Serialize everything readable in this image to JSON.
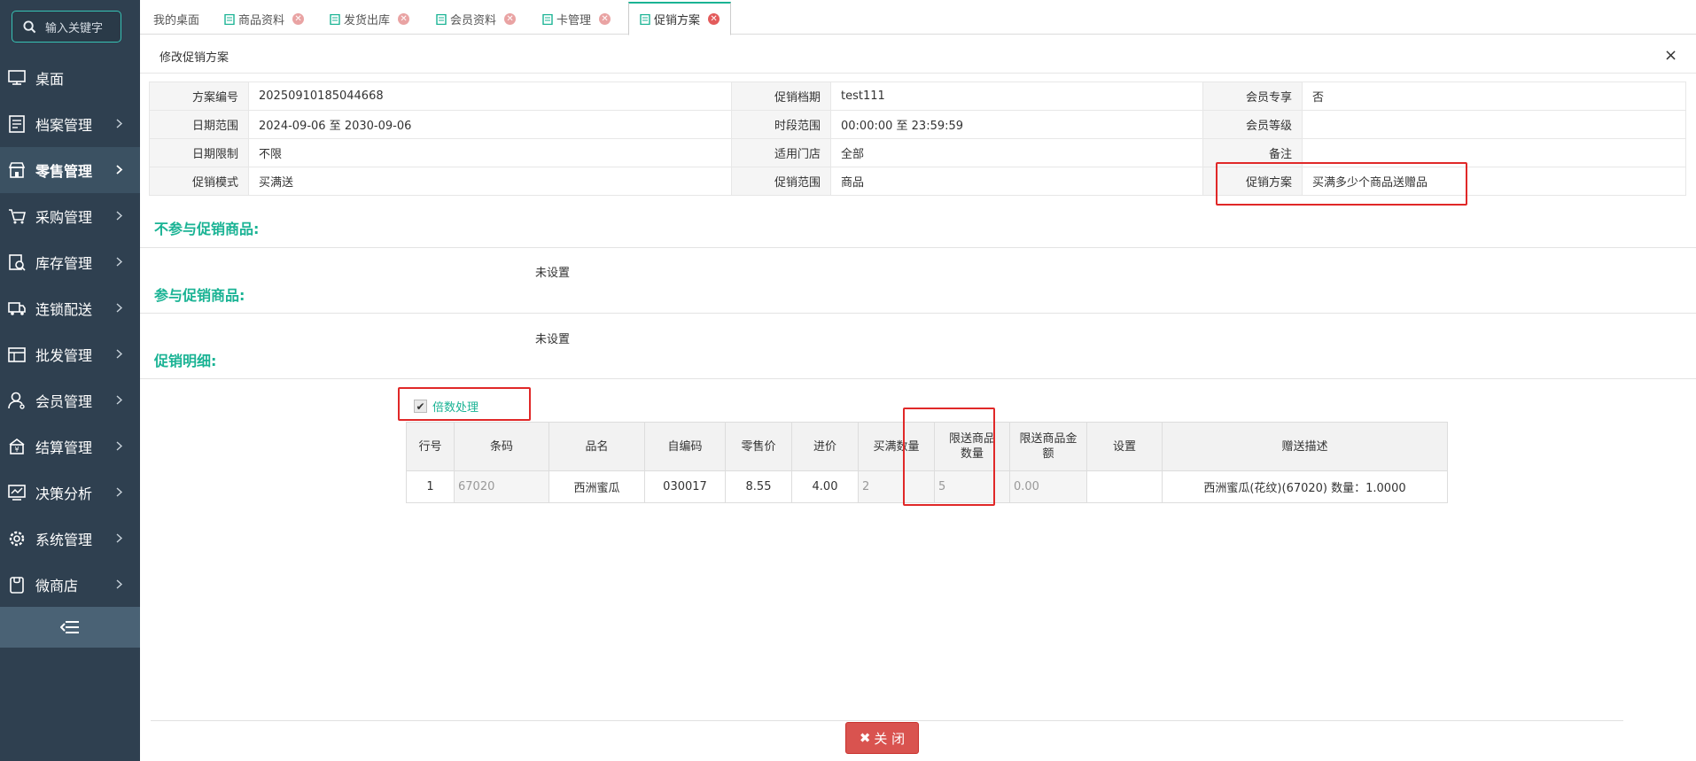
{
  "sidebar": {
    "search_placeholder": "输入关键字",
    "items": [
      {
        "label": "桌面",
        "icon": "monitor-icon"
      },
      {
        "label": "档案管理",
        "icon": "archive-icon"
      },
      {
        "label": "零售管理",
        "icon": "store-icon"
      },
      {
        "label": "采购管理",
        "icon": "purchase-icon"
      },
      {
        "label": "库存管理",
        "icon": "stock-icon"
      },
      {
        "label": "连锁配送",
        "icon": "delivery-icon"
      },
      {
        "label": "批发管理",
        "icon": "wholesale-icon"
      },
      {
        "label": "会员管理",
        "icon": "member-icon"
      },
      {
        "label": "结算管理",
        "icon": "settlement-icon"
      },
      {
        "label": "决策分析",
        "icon": "analysis-icon"
      },
      {
        "label": "系统管理",
        "icon": "settings-icon"
      },
      {
        "label": "微商店",
        "icon": "shop-icon"
      }
    ]
  },
  "tabs": [
    {
      "label": "我的桌面"
    },
    {
      "label": "商品资料"
    },
    {
      "label": "发货出库"
    },
    {
      "label": "会员资料"
    },
    {
      "label": "卡管理"
    },
    {
      "label": "促销方案"
    }
  ],
  "dialog": {
    "title": "修改促销方案",
    "close_icon": "×"
  },
  "info": {
    "rows": [
      [
        {
          "label": "方案编号",
          "value": "20250910185044668"
        },
        {
          "label": "促销档期",
          "value": "test111"
        },
        {
          "label": "会员专享",
          "value": "否"
        }
      ],
      [
        {
          "label": "日期范围",
          "value": "2024-09-06 至 2030-09-06"
        },
        {
          "label": "时段范围",
          "value": "00:00:00 至 23:59:59"
        },
        {
          "label": "会员等级",
          "value": ""
        }
      ],
      [
        {
          "label": "日期限制",
          "value": "不限"
        },
        {
          "label": "适用门店",
          "value": "全部"
        },
        {
          "label": "备注",
          "value": ""
        }
      ],
      [
        {
          "label": "促销模式",
          "value": "买满送"
        },
        {
          "label": "促销范围",
          "value": "商品"
        },
        {
          "label": "促销方案",
          "value": "买满多少个商品送赠品"
        }
      ]
    ]
  },
  "sections": {
    "excluded_title": "不参与促销商品:",
    "excluded_value": "未设置",
    "included_title": "参与促销商品:",
    "included_value": "未设置",
    "detail_title": "促销明细:"
  },
  "multiple": {
    "label": "倍数处理",
    "checked": true
  },
  "grid": {
    "headers": [
      "行号",
      "条码",
      "品名",
      "自编码",
      "零售价",
      "进价",
      "买满数量",
      "限送商品数量",
      "限送商品金额",
      "设置",
      "赠送描述"
    ],
    "rows": [
      [
        "1",
        "67020",
        "西洲蜜瓜",
        "030017",
        "8.55",
        "4.00",
        "2",
        "5",
        "0.00",
        "",
        "西洲蜜瓜(花纹)(67020) 数量：1.0000"
      ]
    ]
  },
  "footer": {
    "close_label": "关 闭"
  },
  "colors": {
    "sidebar_bg": "#2f4050",
    "accent": "#1ab394",
    "danger": "#d9534f",
    "highlight_box": "#e02828"
  }
}
